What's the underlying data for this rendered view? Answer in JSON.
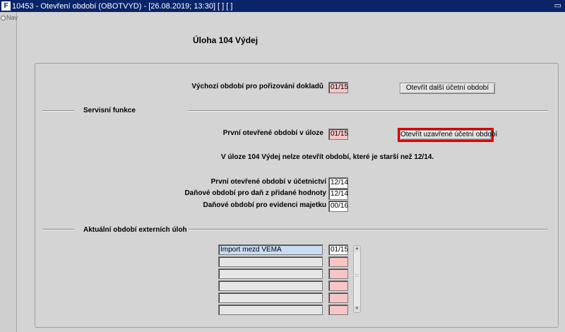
{
  "window": {
    "title": "10453 - Otevření období (OBOTVYD) - [26.08.2019; 13:30]  [ ]  [ ]",
    "app_icon": "app-logo-icon",
    "restore_icon": "restore-window-icon"
  },
  "nav": {
    "label": "Nav",
    "icon": "nav-circle-icon"
  },
  "heading": "Úloha  104 Výdej",
  "default_period": {
    "label": "Výchozí období pro pořizování dokladů",
    "value": "01/15"
  },
  "buttons": {
    "open_next": "Otevřít další účetní období",
    "open_closed": "Otevřít uzavřené účetní období"
  },
  "service_section": {
    "title": "Servisní funkce",
    "first_open_label": "První otevřené období v úloze",
    "first_open_value": "01/15",
    "notice": "V úloze 104 Výdej nelze otevřít období, které je starší než 12/14."
  },
  "periods": {
    "accounting_label": "První otevřené období v účetnictví",
    "accounting_value": "12/14",
    "vat_label": "Daňové období pro daň z přidané hodnoty",
    "vat_value": "12/14",
    "assets_label": "Daňové období pro evidenci majetku",
    "assets_value": "00/16"
  },
  "external_section": {
    "title": "Aktuální období externích úloh",
    "rows": [
      {
        "name": "Import mezd VEMA",
        "period": "01/15"
      },
      {
        "name": "",
        "period": ""
      },
      {
        "name": "",
        "period": ""
      },
      {
        "name": "",
        "period": ""
      },
      {
        "name": "",
        "period": ""
      },
      {
        "name": "",
        "period": ""
      }
    ]
  },
  "colors": {
    "titlebar": "#0a246a",
    "required_field": "#f6c5c5",
    "selected_field": "#c8dcf4",
    "highlight": "#e00000"
  }
}
